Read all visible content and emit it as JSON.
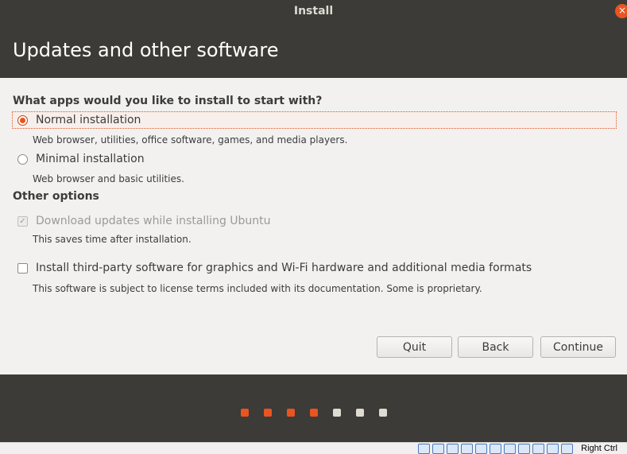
{
  "window": {
    "title": "Install",
    "close_icon": "×"
  },
  "header": {
    "heading": "Updates and other software"
  },
  "install_type": {
    "question": "What apps would you like to install to start with?",
    "options": [
      {
        "label": "Normal installation",
        "description": "Web browser, utilities, office software, games, and media players.",
        "selected": true
      },
      {
        "label": "Minimal installation",
        "description": "Web browser and basic utilities.",
        "selected": false
      }
    ]
  },
  "other_options": {
    "title": "Other options",
    "items": [
      {
        "label": "Download updates while installing Ubuntu",
        "description": "This saves time after installation.",
        "checked": true,
        "disabled": true
      },
      {
        "label": "Install third-party software for graphics and Wi-Fi hardware and additional media formats",
        "description": "This software is subject to license terms included with its documentation. Some is proprietary.",
        "checked": false,
        "disabled": false
      }
    ]
  },
  "buttons": {
    "quit": "Quit",
    "back": "Back",
    "continue": "Continue"
  },
  "progress": {
    "steps_total": 7,
    "steps_done": 4,
    "active_color": "#e95420",
    "inactive_color": "#dfdbd2"
  },
  "vbox_statusbar": {
    "host_key": "Right Ctrl"
  }
}
